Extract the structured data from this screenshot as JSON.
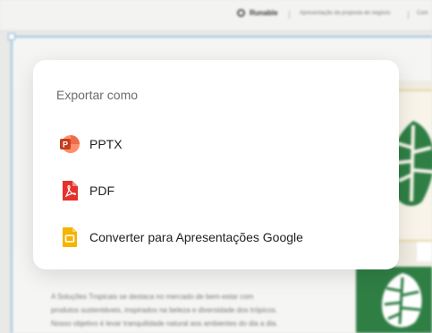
{
  "app": {
    "brand": "Runable",
    "breadcrumb": "Apresentação da proposta de negócio",
    "breadcrumb_next": "Com"
  },
  "slide": {
    "body_lines": [
      "A Soluções Tropicais se destaca no mercado de bem-estar com",
      "produtos sustentáveis, inspirados na beleza e diversidade dos trópicos.",
      "Nosso objetivo é levar tranquilidade natural aos ambientes do dia a dia."
    ]
  },
  "export_modal": {
    "title": "Exportar como",
    "options": [
      {
        "label": "PPTX",
        "icon": "powerpoint-icon"
      },
      {
        "label": "PDF",
        "icon": "pdf-icon"
      },
      {
        "label": "Converter para Apresentações Google",
        "icon": "google-slides-icon"
      }
    ]
  },
  "colors": {
    "powerpoint": "#d24726",
    "pdf": "#e5322d",
    "google_slides": "#f4b400",
    "leaf_green": "#2f7f45"
  }
}
